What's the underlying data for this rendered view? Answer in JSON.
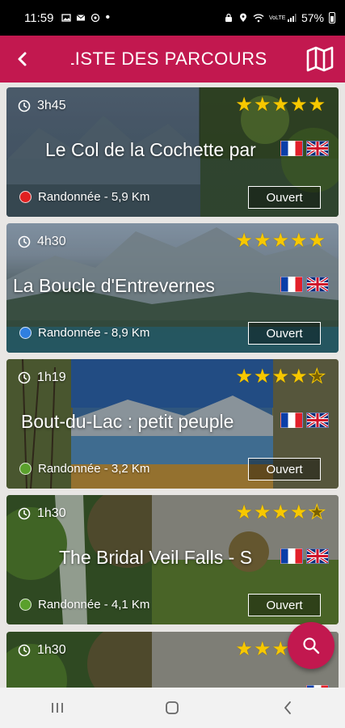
{
  "status_bar": {
    "time": "11:59",
    "battery": "57%",
    "network_label": "VoLTE"
  },
  "app_bar": {
    "title": "LISTE DES PARCOURS"
  },
  "colors": {
    "brand": "#c2184f",
    "star": "#f7c800"
  },
  "cards": [
    {
      "duration": "3h45",
      "rating": 5,
      "title": "Le Col de la Cochette par",
      "activity": "Randonnée - 5,9 Km",
      "dot_color": "#e02020",
      "status": "Ouvert",
      "languages": [
        "fr",
        "en"
      ]
    },
    {
      "duration": "4h30",
      "rating": 5,
      "title": "La Boucle d'Entrevernes",
      "activity": "Randonnée - 8,9 Km",
      "dot_color": "#2f7fe0",
      "status": "Ouvert",
      "languages": [
        "fr",
        "en"
      ]
    },
    {
      "duration": "1h19",
      "rating": 4,
      "title": "Bout-du-Lac : petit peuple",
      "activity": "Randonnée - 3,2 Km",
      "dot_color": "#5aa02c",
      "status": "Ouvert",
      "languages": [
        "fr",
        "en"
      ]
    },
    {
      "duration": "1h30",
      "rating": 4,
      "title": "The Bridal Veil Falls - S",
      "activity": "Randonnée - 4,1 Km",
      "dot_color": "#5aa02c",
      "status": "Ouvert",
      "languages": [
        "fr",
        "en"
      ]
    },
    {
      "duration": "1h30",
      "rating": 4,
      "title": "",
      "activity": "",
      "dot_color": "#5aa02c",
      "status": "",
      "languages": [
        "fr"
      ]
    }
  ],
  "fab": {
    "icon": "search-icon"
  },
  "nav": {
    "icons": [
      "recents-icon",
      "home-icon",
      "back-icon"
    ]
  }
}
